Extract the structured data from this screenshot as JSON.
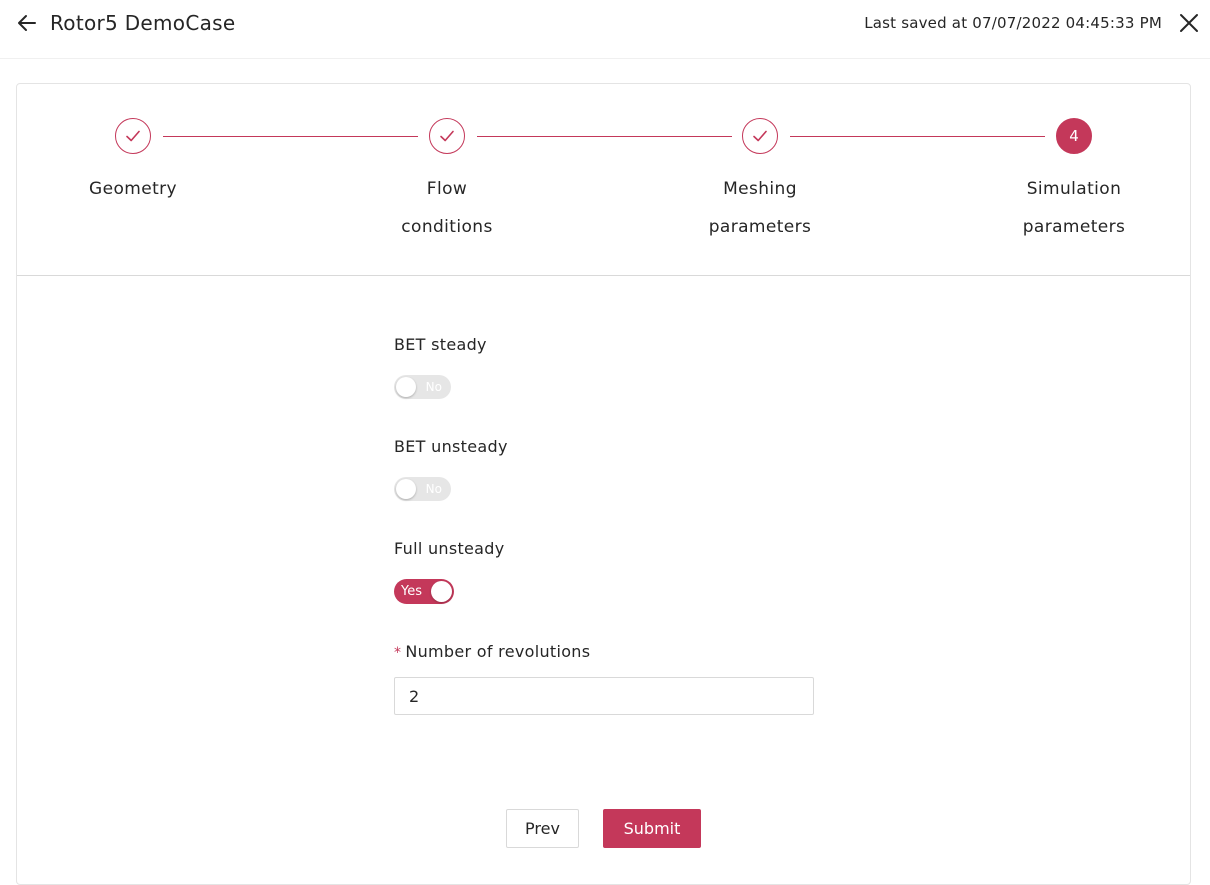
{
  "header": {
    "title": "Rotor5 DemoCase",
    "saved_text": "Last saved at 07/07/2022 04:45:33 PM",
    "back_icon": "arrow-left-icon",
    "close_icon": "close-icon"
  },
  "steps": [
    {
      "label_line1": "Geometry",
      "label_line2": "",
      "status": "done"
    },
    {
      "label_line1": "Flow",
      "label_line2": "conditions",
      "status": "done"
    },
    {
      "label_line1": "Meshing",
      "label_line2": "parameters",
      "status": "done"
    },
    {
      "label_line1": "Simulation",
      "label_line2": "parameters",
      "status": "active",
      "number": "4"
    }
  ],
  "form": {
    "bet_steady": {
      "label": "BET steady",
      "toggle_text": "No",
      "value": false
    },
    "bet_unsteady": {
      "label": "BET unsteady",
      "toggle_text": "No",
      "value": false
    },
    "full_unsteady": {
      "label": "Full unsteady",
      "toggle_text": "Yes",
      "value": true
    },
    "revolutions": {
      "required_mark": "*",
      "label": "Number of revolutions",
      "value": "2"
    }
  },
  "buttons": {
    "prev": "Prev",
    "submit": "Submit"
  },
  "colors": {
    "accent": "#c4385a",
    "toggle_off": "#e6e6e6"
  }
}
